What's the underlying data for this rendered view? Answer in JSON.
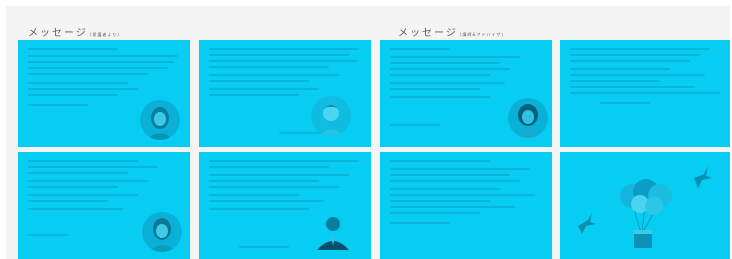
{
  "page": {
    "background": "#f4f4f4",
    "card_color": "#07cdf2"
  },
  "sections": [
    {
      "title": "メッセージ",
      "subtitle": "(保護者より)"
    },
    {
      "title": "メッセージ",
      "subtitle": "(講師&アドバイザ)"
    }
  ],
  "cards": [
    {
      "id": "card-1",
      "image": "portrait-woman-icon"
    },
    {
      "id": "card-2",
      "image": "portrait-child-icon"
    },
    {
      "id": "card-3",
      "image": "portrait-woman-icon"
    },
    {
      "id": "card-4",
      "image": "none"
    },
    {
      "id": "card-5",
      "image": "portrait-woman-icon"
    },
    {
      "id": "card-6",
      "image": "portrait-man-icon"
    },
    {
      "id": "card-7",
      "image": "none"
    },
    {
      "id": "card-8",
      "image": "balloons-birds-illustration"
    }
  ]
}
